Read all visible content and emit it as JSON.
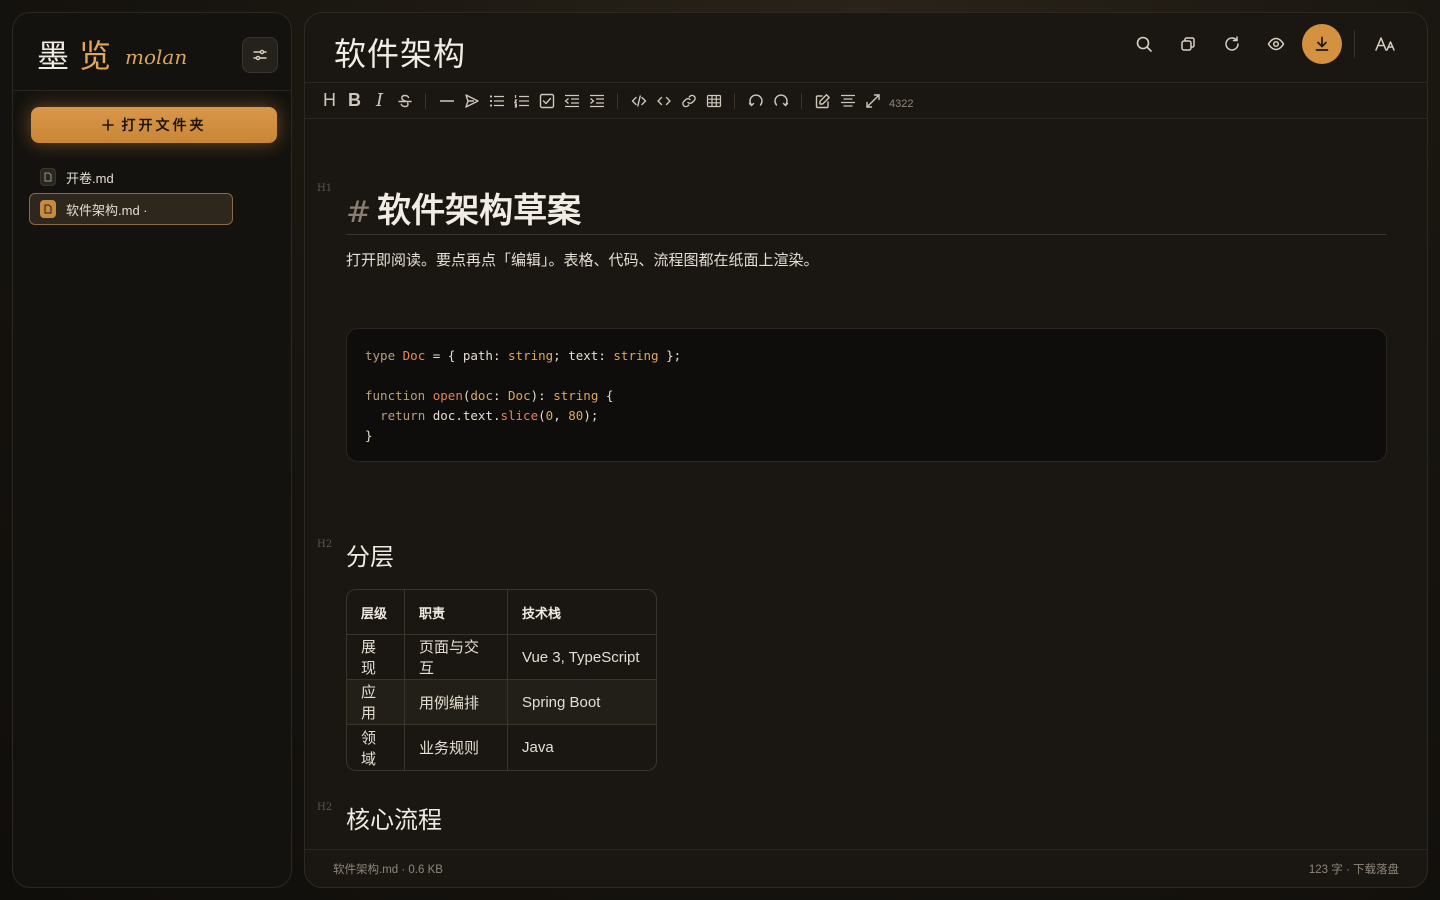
{
  "sidebar": {
    "brand_cn_1": "墨",
    "brand_cn_2": "览",
    "brand_en": "molan",
    "open_folder_label": "打开文件夹",
    "files": [
      {
        "name": "开卷.md"
      },
      {
        "name": "软件架构.md ·"
      }
    ]
  },
  "header": {
    "title": "软件架构"
  },
  "toolbar": {
    "heading": "H",
    "bold": "B",
    "italic": "I",
    "count": "4322"
  },
  "doc": {
    "h1_hash": "#",
    "h1": "软件架构草案",
    "paragraph": "打开即阅读。要点再点「编辑」。表格、代码、流程图都在纸面上渲染。",
    "h1_marker": "H1",
    "h2_marker": "H2",
    "code_lines": [
      "type Doc = { path: string; text: string };",
      "",
      "function open(doc: Doc): string {",
      "  return doc.text.slice(0, 80);",
      "}"
    ],
    "h2_layers": "分层",
    "table": {
      "headers": [
        "层级",
        "职责",
        "技术栈"
      ],
      "rows": [
        [
          "展现",
          "页面与交互",
          "Vue 3, TypeScript"
        ],
        [
          "应用",
          "用例编排",
          "Spring Boot"
        ],
        [
          "领域",
          "业务规则",
          "Java"
        ]
      ]
    },
    "h2_flow": "核心流程"
  },
  "footer": {
    "left": "软件架构.md · 0.6 KB",
    "right": "123 字 · 下载落盘"
  },
  "colors": {
    "accent": "#d4913f",
    "background": "#1a1713"
  }
}
